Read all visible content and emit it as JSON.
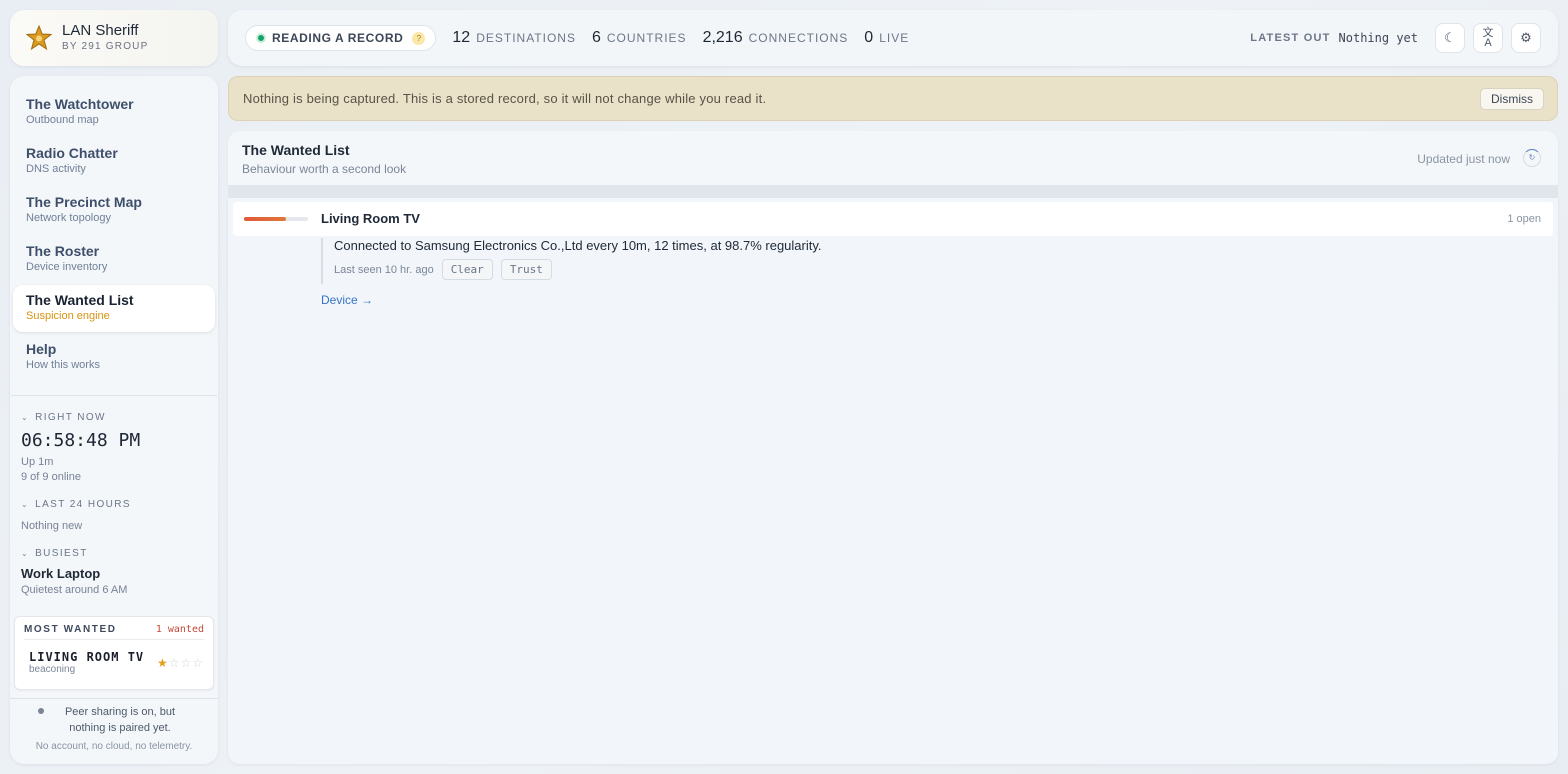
{
  "brand": {
    "title": "LAN Sheriff",
    "subtitle": "BY 291 GROUP"
  },
  "nav": [
    {
      "title": "The Watchtower",
      "subtitle": "Outbound map",
      "active": false
    },
    {
      "title": "Radio Chatter",
      "subtitle": "DNS activity",
      "active": false
    },
    {
      "title": "The Precinct Map",
      "subtitle": "Network topology",
      "active": false
    },
    {
      "title": "The Roster",
      "subtitle": "Device inventory",
      "active": false
    },
    {
      "title": "The Wanted List",
      "subtitle": "Suspicion engine",
      "active": true
    },
    {
      "title": "Help",
      "subtitle": "How this works",
      "active": false
    }
  ],
  "right_now": {
    "heading": "RIGHT NOW",
    "clock": "06:58:48 PM",
    "uptime": "Up 1m",
    "online": "9 of 9 online"
  },
  "last24": {
    "heading": "LAST 24 HOURS",
    "text": "Nothing new"
  },
  "busiest": {
    "heading": "BUSIEST",
    "name": "Work Laptop",
    "note": "Quietest around 6 AM"
  },
  "most_wanted": {
    "heading": "MOST WANTED",
    "count": "1 wanted",
    "entry": {
      "name": "LIVING ROOM TV",
      "behaviour": "beaconing",
      "stars": 1,
      "stars_max": 4
    }
  },
  "footer": {
    "peer": "Peer sharing is on, but nothing is paired yet.",
    "privacy": "No account, no cloud, no telemetry."
  },
  "topbar": {
    "mode": "READING A RECORD",
    "help": "?",
    "stats": [
      {
        "value": "12",
        "label": "DESTINATIONS"
      },
      {
        "value": "6",
        "label": "COUNTRIES"
      },
      {
        "value": "2,216",
        "label": "CONNECTIONS"
      },
      {
        "value": "0",
        "label": "LIVE"
      }
    ],
    "latest_label": "LATEST OUT",
    "latest_value": "Nothing yet",
    "icons": [
      "moon-icon",
      "translate-icon",
      "gear-icon"
    ]
  },
  "banner": {
    "message": "Nothing is being captured. This is a stored record, so it will not change while you read it.",
    "dismiss": "Dismiss"
  },
  "panel": {
    "title": "The Wanted List",
    "subtitle": "Behaviour worth a second look",
    "updated": "Updated just now"
  },
  "cases": [
    {
      "name": "Living Room TV",
      "open": "1 open",
      "severity": 0.65,
      "finding": "Connected to Samsung Electronics Co.,Ltd every 10m, 12 times, at 98.7% regularity.",
      "last_seen": "Last seen 10 hr. ago",
      "actions": [
        "Clear",
        "Trust"
      ],
      "link": "Device →"
    }
  ],
  "colors": {
    "accent": "#d69412",
    "live": "#16a36a",
    "danger": "#c24a3a",
    "link": "#3573c4"
  }
}
